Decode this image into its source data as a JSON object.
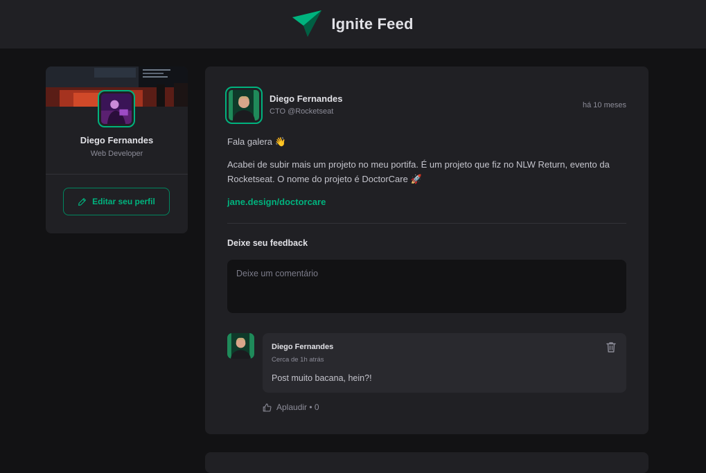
{
  "header": {
    "title": "Ignite Feed",
    "logo_icon": "ignite-logo-icon",
    "accent": "#00b37e"
  },
  "sidebar": {
    "name": "Diego Fernandes",
    "role": "Web Developer",
    "edit_button_label": "Editar seu perfil",
    "edit_icon": "pencil-icon"
  },
  "post": {
    "author": {
      "name": "Diego Fernandes",
      "role": "CTO @Rocketseat"
    },
    "time": "há 10 meses",
    "content": {
      "greeting": "Fala galera 👋",
      "paragraph": "Acabei de subir mais um projeto no meu portifa. É um projeto que fiz no NLW Return, evento da Rocketseat. O nome do projeto é DoctorCare 🚀",
      "link": "jane.design/doctorcare"
    },
    "feedback": {
      "title": "Deixe seu feedback",
      "placeholder": "Deixe um comentário"
    },
    "comment": {
      "author": "Diego Fernandes",
      "time": "Cerca de 1h atrás",
      "text": "Post muito bacana, hein?!",
      "applaud_label": "Aplaudir • 0",
      "delete_icon": "trash-icon",
      "applaud_icon": "thumbs-up-icon"
    }
  }
}
